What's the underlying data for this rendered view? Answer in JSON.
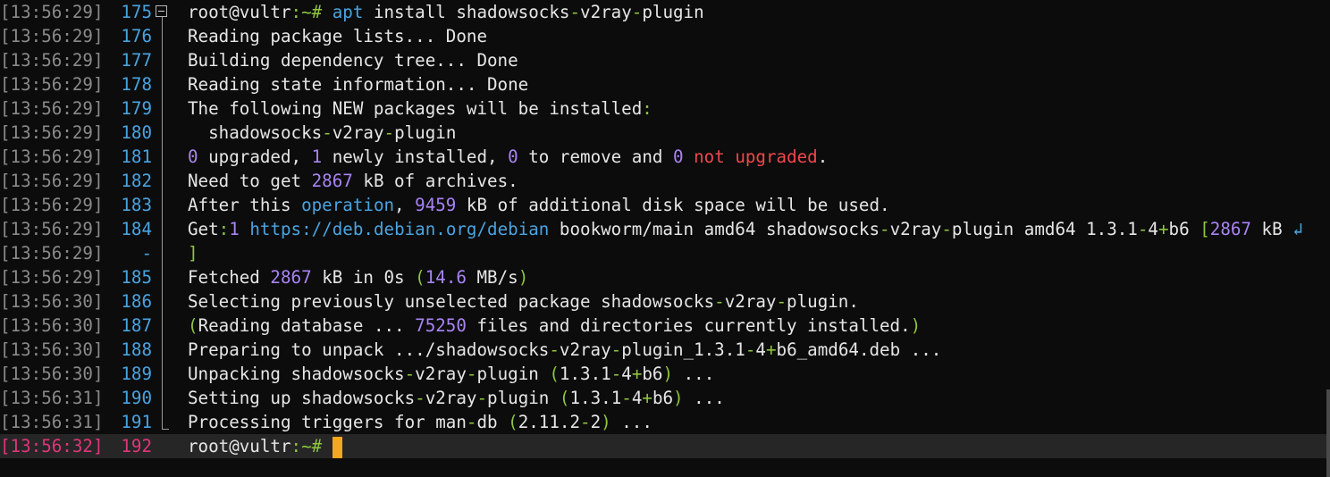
{
  "colors": {
    "background": "#0c0c0c",
    "text": "#e6e6e6",
    "timestamp": "#8a8a8a",
    "line_number": "#4aa3e0",
    "current_line_marker": "#e0357a",
    "current_line_bg": "#262626",
    "symbol_green": "#8ec63f",
    "number_purple": "#a884f3",
    "keyword_red": "#f0474b",
    "link_blue": "#4aa3e0",
    "cursor": "#f5a623"
  },
  "lines": [
    {
      "ts": "[13:56:29]",
      "ln": "175",
      "segs": [
        {
          "t": "root@vultr",
          "c": "#e6e6e6"
        },
        {
          "t": ":~#",
          "c": "#8ec63f"
        },
        {
          "t": " ",
          "c": "#e6e6e6"
        },
        {
          "t": "apt",
          "c": "#4aa3e0"
        },
        {
          "t": " install shadowsocks",
          "c": "#e6e6e6"
        },
        {
          "t": "-",
          "c": "#8ec63f"
        },
        {
          "t": "v2ray",
          "c": "#e6e6e6"
        },
        {
          "t": "-",
          "c": "#8ec63f"
        },
        {
          "t": "plugin",
          "c": "#e6e6e6"
        }
      ]
    },
    {
      "ts": "[13:56:29]",
      "ln": "176",
      "segs": [
        {
          "t": "Reading package lists",
          "c": "#e6e6e6"
        },
        {
          "t": "...",
          "c": "#e6e6e6"
        },
        {
          "t": " Done",
          "c": "#e6e6e6"
        }
      ]
    },
    {
      "ts": "[13:56:29]",
      "ln": "177",
      "segs": [
        {
          "t": "Building dependency tree",
          "c": "#e6e6e6"
        },
        {
          "t": "...",
          "c": "#e6e6e6"
        },
        {
          "t": " Done",
          "c": "#e6e6e6"
        }
      ]
    },
    {
      "ts": "[13:56:29]",
      "ln": "178",
      "segs": [
        {
          "t": "Reading state information",
          "c": "#e6e6e6"
        },
        {
          "t": "...",
          "c": "#e6e6e6"
        },
        {
          "t": " Done",
          "c": "#e6e6e6"
        }
      ]
    },
    {
      "ts": "[13:56:29]",
      "ln": "179",
      "segs": [
        {
          "t": "The following NEW packages will be installed",
          "c": "#e6e6e6"
        },
        {
          "t": ":",
          "c": "#8ec63f"
        }
      ]
    },
    {
      "ts": "[13:56:29]",
      "ln": "180",
      "segs": [
        {
          "t": "  shadowsocks",
          "c": "#e6e6e6"
        },
        {
          "t": "-",
          "c": "#8ec63f"
        },
        {
          "t": "v2ray",
          "c": "#e6e6e6"
        },
        {
          "t": "-",
          "c": "#8ec63f"
        },
        {
          "t": "plugin",
          "c": "#e6e6e6"
        }
      ]
    },
    {
      "ts": "[13:56:29]",
      "ln": "181",
      "segs": [
        {
          "t": "0",
          "c": "#a884f3"
        },
        {
          "t": " upgraded, ",
          "c": "#e6e6e6"
        },
        {
          "t": "1",
          "c": "#a884f3"
        },
        {
          "t": " newly installed, ",
          "c": "#e6e6e6"
        },
        {
          "t": "0",
          "c": "#a884f3"
        },
        {
          "t": " to remove and ",
          "c": "#e6e6e6"
        },
        {
          "t": "0",
          "c": "#a884f3"
        },
        {
          "t": " ",
          "c": "#e6e6e6"
        },
        {
          "t": "not upgraded",
          "c": "#f0474b"
        },
        {
          "t": ".",
          "c": "#e6e6e6"
        }
      ]
    },
    {
      "ts": "[13:56:29]",
      "ln": "182",
      "segs": [
        {
          "t": "Need to get ",
          "c": "#e6e6e6"
        },
        {
          "t": "2867",
          "c": "#a884f3"
        },
        {
          "t": " kB of archives.",
          "c": "#e6e6e6"
        }
      ]
    },
    {
      "ts": "[13:56:29]",
      "ln": "183",
      "segs": [
        {
          "t": "After this ",
          "c": "#e6e6e6"
        },
        {
          "t": "operation",
          "c": "#4aa3e0"
        },
        {
          "t": ", ",
          "c": "#e6e6e6"
        },
        {
          "t": "9459",
          "c": "#a884f3"
        },
        {
          "t": " kB of additional disk space will be used.",
          "c": "#e6e6e6"
        }
      ]
    },
    {
      "ts": "[13:56:29]",
      "ln": "184",
      "segs": [
        {
          "t": "Get",
          "c": "#e6e6e6"
        },
        {
          "t": ":",
          "c": "#8ec63f"
        },
        {
          "t": "1",
          "c": "#a884f3"
        },
        {
          "t": " ",
          "c": "#e6e6e6"
        },
        {
          "t": "https://deb.debian.org/debian",
          "c": "#4aa3e0"
        },
        {
          "t": " bookworm/main amd64 shadowsocks",
          "c": "#e6e6e6"
        },
        {
          "t": "-",
          "c": "#8ec63f"
        },
        {
          "t": "v2ray",
          "c": "#e6e6e6"
        },
        {
          "t": "-",
          "c": "#8ec63f"
        },
        {
          "t": "plugin amd64 1.3.1",
          "c": "#e6e6e6"
        },
        {
          "t": "-",
          "c": "#8ec63f"
        },
        {
          "t": "4",
          "c": "#e6e6e6"
        },
        {
          "t": "+",
          "c": "#8ec63f"
        },
        {
          "t": "b6 ",
          "c": "#e6e6e6"
        },
        {
          "t": "[",
          "c": "#8ec63f"
        },
        {
          "t": "2867",
          "c": "#a884f3"
        },
        {
          "t": " kB ",
          "c": "#e6e6e6"
        },
        {
          "t": "↲",
          "c": "#4aa3e0"
        }
      ]
    },
    {
      "ts": "[13:56:29]",
      "ln": "-",
      "segs": [
        {
          "t": "]",
          "c": "#8ec63f"
        }
      ]
    },
    {
      "ts": "[13:56:29]",
      "ln": "185",
      "segs": [
        {
          "t": "Fetched ",
          "c": "#e6e6e6"
        },
        {
          "t": "2867",
          "c": "#a884f3"
        },
        {
          "t": " kB in 0s ",
          "c": "#e6e6e6"
        },
        {
          "t": "(",
          "c": "#8ec63f"
        },
        {
          "t": "14.6",
          "c": "#a884f3"
        },
        {
          "t": " MB/s",
          "c": "#e6e6e6"
        },
        {
          "t": ")",
          "c": "#8ec63f"
        }
      ]
    },
    {
      "ts": "[13:56:30]",
      "ln": "186",
      "segs": [
        {
          "t": "Selecting previously unselected package shadowsocks",
          "c": "#e6e6e6"
        },
        {
          "t": "-",
          "c": "#8ec63f"
        },
        {
          "t": "v2ray",
          "c": "#e6e6e6"
        },
        {
          "t": "-",
          "c": "#8ec63f"
        },
        {
          "t": "plugin.",
          "c": "#e6e6e6"
        }
      ]
    },
    {
      "ts": "[13:56:30]",
      "ln": "187",
      "segs": [
        {
          "t": "(",
          "c": "#8ec63f"
        },
        {
          "t": "Reading database ... ",
          "c": "#e6e6e6"
        },
        {
          "t": "75250",
          "c": "#a884f3"
        },
        {
          "t": " files and directories currently installed.",
          "c": "#e6e6e6"
        },
        {
          "t": ")",
          "c": "#8ec63f"
        }
      ]
    },
    {
      "ts": "[13:56:30]",
      "ln": "188",
      "segs": [
        {
          "t": "Preparing to unpack .../shadowsocks",
          "c": "#e6e6e6"
        },
        {
          "t": "-",
          "c": "#8ec63f"
        },
        {
          "t": "v2ray",
          "c": "#e6e6e6"
        },
        {
          "t": "-",
          "c": "#8ec63f"
        },
        {
          "t": "plugin_1.3.1",
          "c": "#e6e6e6"
        },
        {
          "t": "-",
          "c": "#8ec63f"
        },
        {
          "t": "4",
          "c": "#e6e6e6"
        },
        {
          "t": "+",
          "c": "#8ec63f"
        },
        {
          "t": "b6_amd64.deb ...",
          "c": "#e6e6e6"
        }
      ]
    },
    {
      "ts": "[13:56:30]",
      "ln": "189",
      "segs": [
        {
          "t": "Unpacking shadowsocks",
          "c": "#e6e6e6"
        },
        {
          "t": "-",
          "c": "#8ec63f"
        },
        {
          "t": "v2ray",
          "c": "#e6e6e6"
        },
        {
          "t": "-",
          "c": "#8ec63f"
        },
        {
          "t": "plugin ",
          "c": "#e6e6e6"
        },
        {
          "t": "(",
          "c": "#8ec63f"
        },
        {
          "t": "1.3.1",
          "c": "#e6e6e6"
        },
        {
          "t": "-",
          "c": "#8ec63f"
        },
        {
          "t": "4",
          "c": "#e6e6e6"
        },
        {
          "t": "+",
          "c": "#8ec63f"
        },
        {
          "t": "b6",
          "c": "#e6e6e6"
        },
        {
          "t": ")",
          "c": "#8ec63f"
        },
        {
          "t": " ...",
          "c": "#e6e6e6"
        }
      ]
    },
    {
      "ts": "[13:56:31]",
      "ln": "190",
      "segs": [
        {
          "t": "Setting up shadowsocks",
          "c": "#e6e6e6"
        },
        {
          "t": "-",
          "c": "#8ec63f"
        },
        {
          "t": "v2ray",
          "c": "#e6e6e6"
        },
        {
          "t": "-",
          "c": "#8ec63f"
        },
        {
          "t": "plugin ",
          "c": "#e6e6e6"
        },
        {
          "t": "(",
          "c": "#8ec63f"
        },
        {
          "t": "1.3.1",
          "c": "#e6e6e6"
        },
        {
          "t": "-",
          "c": "#8ec63f"
        },
        {
          "t": "4",
          "c": "#e6e6e6"
        },
        {
          "t": "+",
          "c": "#8ec63f"
        },
        {
          "t": "b6",
          "c": "#e6e6e6"
        },
        {
          "t": ")",
          "c": "#8ec63f"
        },
        {
          "t": " ...",
          "c": "#e6e6e6"
        }
      ]
    },
    {
      "ts": "[13:56:31]",
      "ln": "191",
      "segs": [
        {
          "t": "Processing triggers for man",
          "c": "#e6e6e6"
        },
        {
          "t": "-",
          "c": "#8ec63f"
        },
        {
          "t": "db ",
          "c": "#e6e6e6"
        },
        {
          "t": "(",
          "c": "#8ec63f"
        },
        {
          "t": "2.11.2",
          "c": "#e6e6e6"
        },
        {
          "t": "-",
          "c": "#8ec63f"
        },
        {
          "t": "2",
          "c": "#e6e6e6"
        },
        {
          "t": ")",
          "c": "#8ec63f"
        },
        {
          "t": " ...",
          "c": "#e6e6e6"
        }
      ]
    },
    {
      "ts": "[13:56:32]",
      "ln": "192",
      "current": true,
      "segs": [
        {
          "t": "root@vultr",
          "c": "#e6e6e6"
        },
        {
          "t": ":~#",
          "c": "#8ec63f"
        },
        {
          "t": " ",
          "c": "#e6e6e6"
        }
      ]
    }
  ]
}
